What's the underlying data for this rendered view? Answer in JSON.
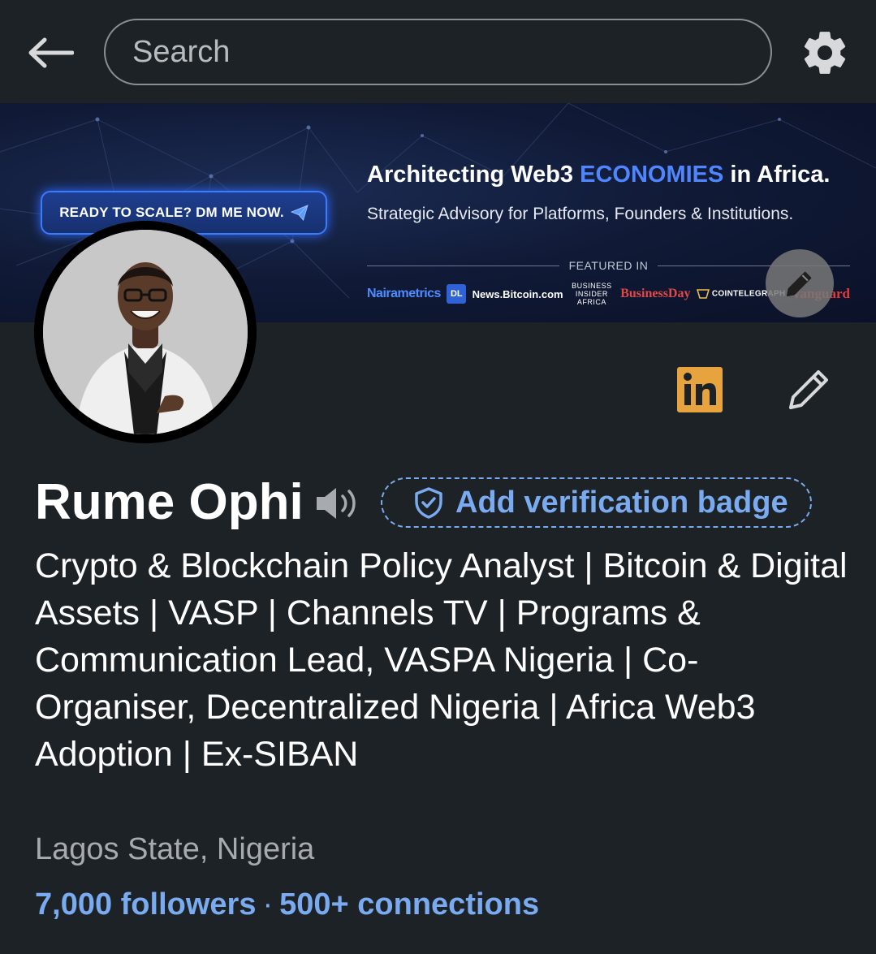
{
  "search": {
    "placeholder": "Search"
  },
  "icons": {
    "back": "arrow-left-icon",
    "settings": "gear-icon",
    "banner_edit": "pencil-icon",
    "linkedin": "linkedin-icon",
    "edit": "pencil-icon",
    "speaker": "speaker-icon",
    "verify": "shield-check-icon"
  },
  "banner": {
    "cta": "READY TO SCALE? DM ME NOW.",
    "title_prefix": "Architecting Web3 ",
    "title_highlight": "ECONOMIES",
    "title_suffix": " in Africa.",
    "subtitle": "Strategic Advisory for Platforms, Founders & Institutions.",
    "featured_label": "FEATURED IN",
    "logos": {
      "nairametrics": "Nairametrics",
      "dl_news": "DL",
      "news_bitcoin": "News.Bitcoin.com",
      "business_insider": "BUSINESS INSIDER AFRICA",
      "businessday": "BusinessDay",
      "cointelegraph": "COINTELEGRAPH",
      "vanguard": "Vanguard"
    }
  },
  "profile": {
    "name": "Rume Ophi",
    "verify_label": "Add verification badge",
    "headline": "Crypto & Blockchain Policy Analyst | Bitcoin & Digital Assets | VASP | Channels TV | Programs & Communication Lead, VASPA Nigeria | Co-Organiser, Decentralized Nigeria | Africa Web3 Adoption | Ex-SIBAN",
    "location": "Lagos State, Nigeria",
    "followers": "7,000 followers",
    "separator": "·",
    "connections": "500+ connections"
  },
  "colors": {
    "background": "#1d2226",
    "link": "#7aaaf0",
    "banner_accent": "#4f86ff",
    "linkedin_badge": "#e7a33e"
  }
}
